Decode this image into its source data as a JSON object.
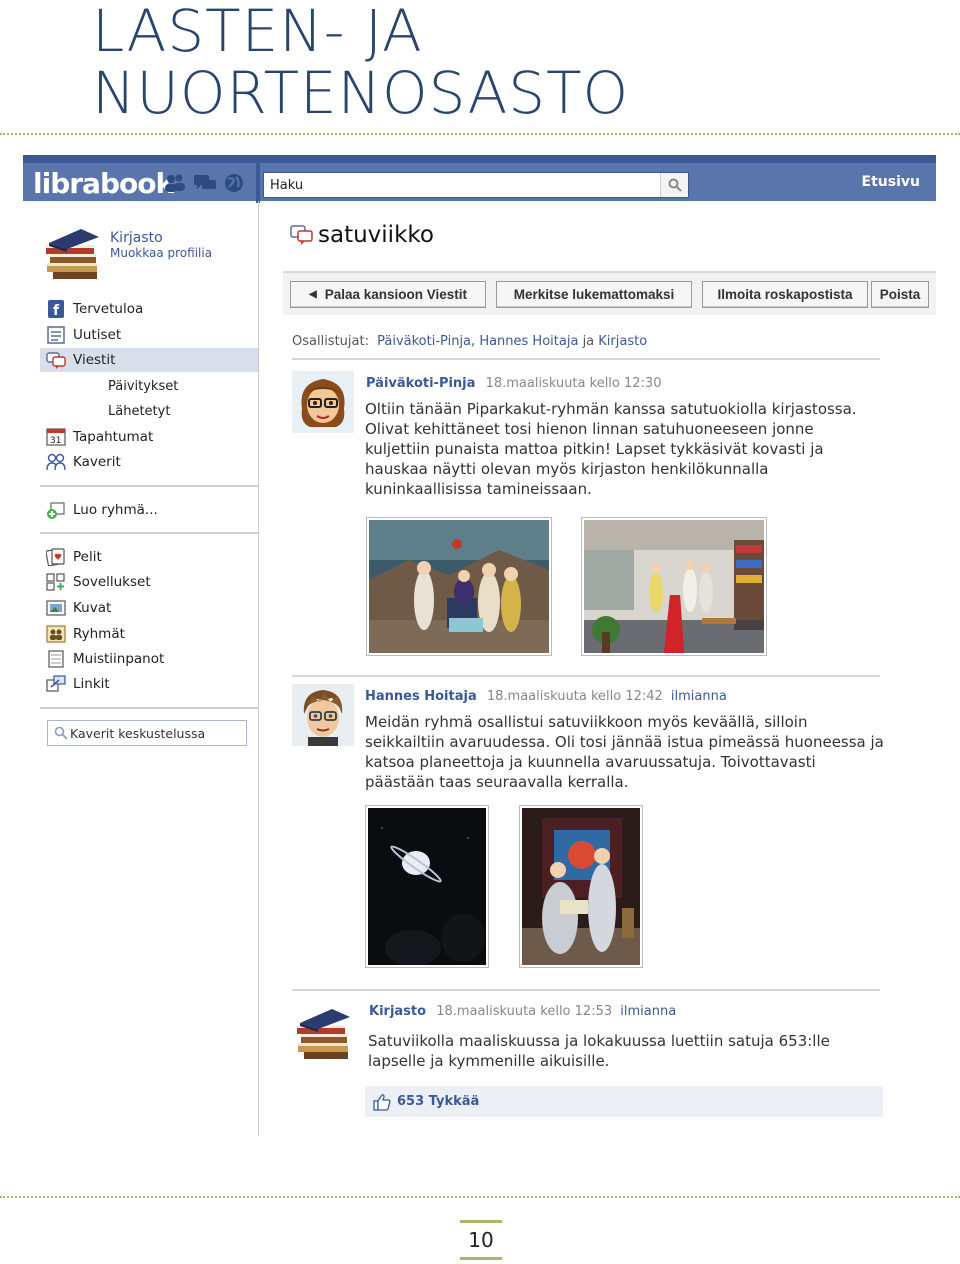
{
  "page_heading": [
    "LASTEN- JA",
    "NUORTENOSASTO"
  ],
  "app": {
    "logo": "librabook",
    "search_value": "Haku",
    "home_link": "Etusivu"
  },
  "profile": {
    "name": "Kirjasto",
    "edit_link": "Muokkaa profiilia"
  },
  "nav": {
    "welcome": "Tervetuloa",
    "news": "Uutiset",
    "messages": "Viestit",
    "updates": "Päivitykset",
    "sent": "Lähetetyt",
    "events": "Tapahtumat",
    "events_badge": "31",
    "friends": "Kaverit",
    "create_group": "Luo ryhmä...",
    "games": "Pelit",
    "apps": "Sovellukset",
    "photos": "Kuvat",
    "groups": "Ryhmät",
    "notes": "Muistiinpanot",
    "links": "Linkit",
    "chat_search": "Kaverit keskustelussa"
  },
  "thread": {
    "title": "satuviikko",
    "buttons": {
      "back": "Palaa kansioon Viestit",
      "mark_unread": "Merkitse lukemattomaksi",
      "report_spam": "Ilmoita roskapostista",
      "delete": "Poista"
    },
    "participants_label": "Osallistujat:",
    "participants": [
      "Päiväkoti-Pinja",
      "Hannes Hoitaja",
      "Kirjasto"
    ],
    "participants_sep1": ",",
    "participants_sep2": "ja"
  },
  "messages": [
    {
      "author": "Päiväkoti-Pinja",
      "time": "18.maaliskuuta kello 12:30",
      "body": "Oltiin tänään Piparkakut-ryhmän kanssa satutuokiolla kirjastossa. Olivat kehittäneet tosi hienon linnan satuhuoneeseen jonne kuljettiin punaista mattoa pitkin! Lapset tykkäsivät kovasti ja hauskaa näytti olevan myös kirjaston henkilökunnalla kuninkaallisissa tamineissaan."
    },
    {
      "author": "Hannes Hoitaja",
      "time": "18.maaliskuuta kello 12:42",
      "report": "ilmianna",
      "body": "Meidän ryhmä osallistui satuviikkoon myös keväällä, silloin seikkailtiin avaruudessa. Oli tosi jännää istua pimeässä huoneessa ja katsoa planeettoja ja kuunnella avaruussatuja. Toivottavasti päästään taas seuraavalla kerralla."
    },
    {
      "author": "Kirjasto",
      "time": "18.maaliskuuta kello 12:53",
      "report": "ilmianna",
      "body": "Satuviikolla maaliskuussa ja lokakuussa luettiin satuja 653:lle lapselle ja kymmenille aikuisille."
    }
  ],
  "likes": "653 Tykkää",
  "page_number": "10",
  "colors": {
    "brand": "#3b5998",
    "topbar_light": "#5a75ab",
    "accent_green": "#a7b86e",
    "heading": "#2a4470"
  }
}
